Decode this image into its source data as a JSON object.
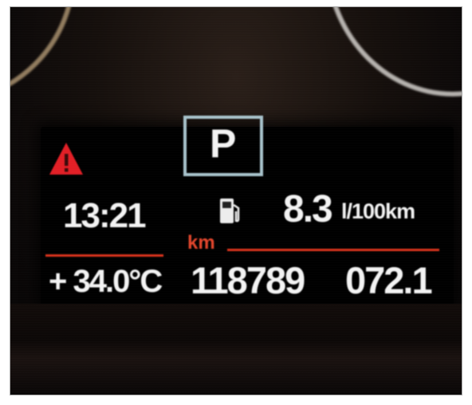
{
  "photo": {
    "subject": "car instrument cluster display"
  },
  "cluster": {
    "gear": "P",
    "clock": "13:21",
    "consumption": {
      "value": "8.3",
      "unit": "l/100km"
    },
    "odometer": {
      "label": "km",
      "value": "118789"
    },
    "trip": "072.1",
    "temperature": "+ 34.0°C",
    "warning_icon": "warning-triangle-icon",
    "fuel_icon": "fuel-pump-icon"
  },
  "colors": {
    "warning": "#e21f26",
    "accent_red": "#d9331c",
    "text": "#f3f3f3",
    "gear_border": "#a8c3cc"
  }
}
